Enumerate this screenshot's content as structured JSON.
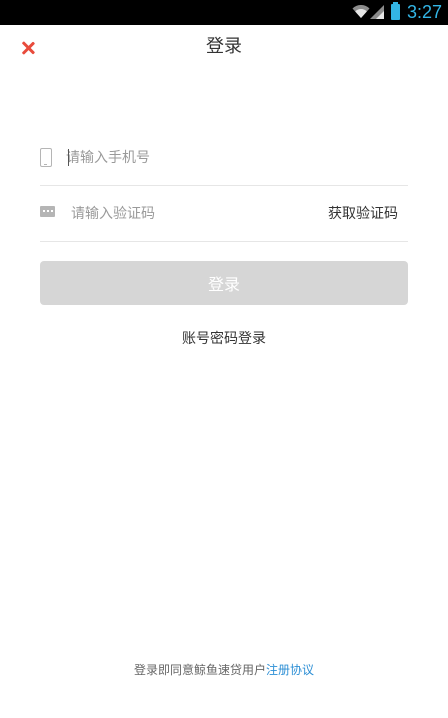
{
  "status_bar": {
    "time": "3:27",
    "icons": [
      "wifi-icon",
      "signal-icon",
      "battery-icon"
    ],
    "accent_color": "#33b5e5"
  },
  "header": {
    "title": "登录",
    "close_icon": "close-icon",
    "close_color": "#e84b3c"
  },
  "form": {
    "phone": {
      "icon": "phone-icon",
      "placeholder": "请输入手机号",
      "value": ""
    },
    "code": {
      "icon": "message-icon",
      "placeholder": "请输入验证码",
      "value": "",
      "get_code_label": "获取验证码"
    },
    "login_label": "登录",
    "login_disabled_color": "#d6d6d6"
  },
  "account_login_label": "账号密码登录",
  "agreement": {
    "prefix": "登录即同意鲸鱼速贷用户",
    "link_label": "注册协议",
    "link_color": "#2d8fd5"
  }
}
